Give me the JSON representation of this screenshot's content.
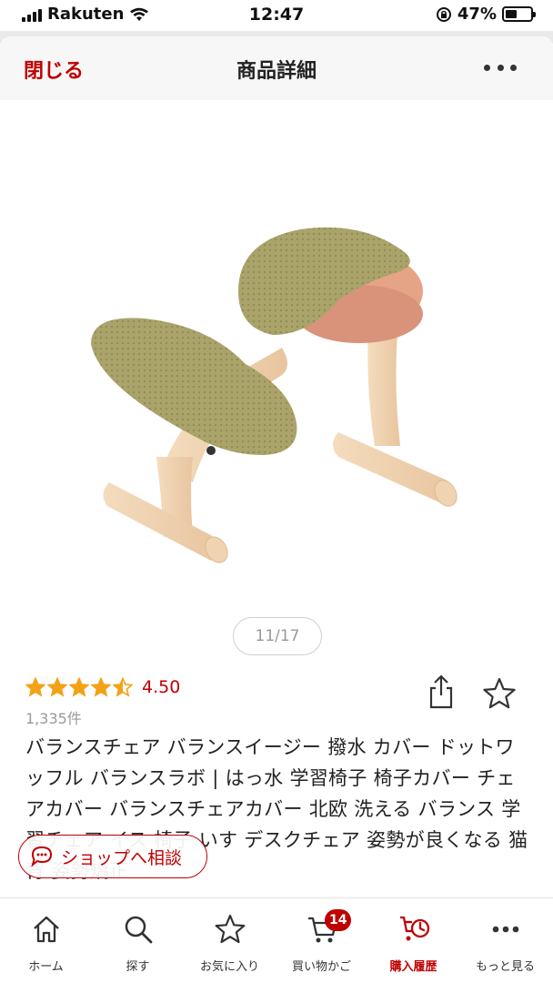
{
  "status_bar": {
    "carrier": "Rakuten",
    "time": "12:47",
    "battery": "47%",
    "battery_level": 0.47
  },
  "header": {
    "close_label": "閉じる",
    "title": "商品詳細"
  },
  "gallery": {
    "counter": "11/17",
    "current": 11,
    "total": 17
  },
  "product": {
    "rating_value": "4.50",
    "rating_stars": 4.5,
    "review_count": "1,335件",
    "title": "バランスチェア バランスイージー 撥水 カバー ドットワッフル バランスラボ | はっ水 学習椅子 椅子カバー チェアカバー バランスチェアカバー 北欧 洗える バランス 学習チェア イス 椅子 いす デスクチェア 姿勢が良くなる 猫背 姿勢矯正"
  },
  "shop_chat": {
    "label": "ショップへ相談"
  },
  "tabbar": {
    "items": [
      {
        "label": "ホーム",
        "icon": "home-icon"
      },
      {
        "label": "探す",
        "icon": "search-icon"
      },
      {
        "label": "お気に入り",
        "icon": "star-icon"
      },
      {
        "label": "買い物かご",
        "icon": "cart-icon",
        "badge": "14"
      },
      {
        "label": "購入履歴",
        "icon": "history-icon",
        "active": true
      },
      {
        "label": "もっと見る",
        "icon": "more-icon"
      }
    ]
  },
  "colors": {
    "accent": "#bf0000",
    "star": "#f3a217",
    "chair_cover": "#a9a266",
    "chair_wood": "#f1d4b1",
    "seat_pink": "#e2a084"
  }
}
